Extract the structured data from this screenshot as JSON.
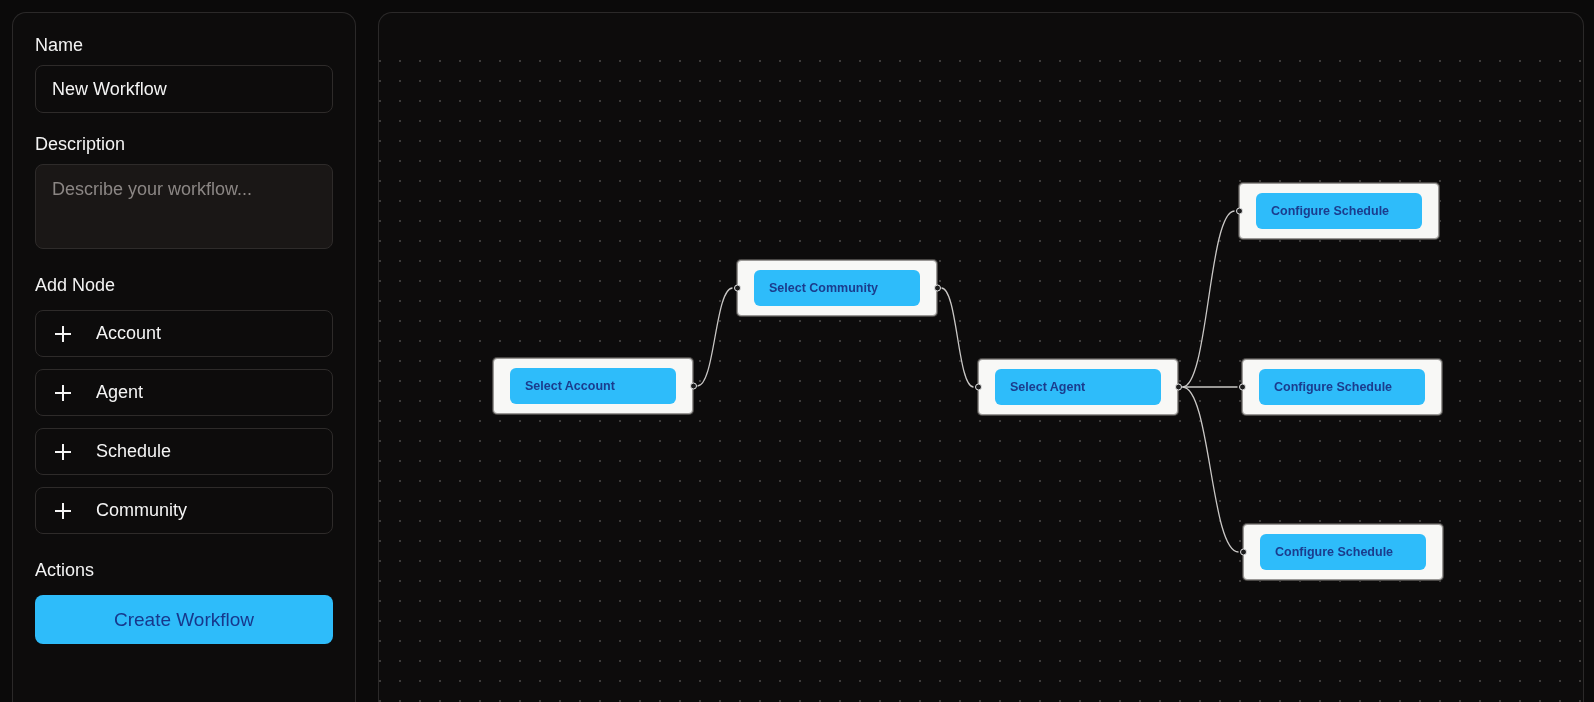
{
  "sidebar": {
    "name_field": {
      "label": "Name",
      "value": "New Workflow"
    },
    "description_field": {
      "label": "Description",
      "placeholder": "Describe your workflow..."
    },
    "add_node": {
      "heading": "Add Node",
      "buttons": [
        {
          "label": "Account"
        },
        {
          "label": "Agent"
        },
        {
          "label": "Schedule"
        },
        {
          "label": "Community"
        }
      ]
    },
    "actions": {
      "heading": "Actions",
      "create_button": {
        "label": "Create Workflow"
      }
    }
  },
  "canvas": {
    "nodes": [
      {
        "label": "Select Account",
        "children": [
          {
            "label": "Select Community",
            "children": [
              {
                "label": "Select Agent",
                "children": [
                  {
                    "label": "Configure Schedule"
                  },
                  {
                    "label": "Configure Schedule"
                  },
                  {
                    "label": "Configure Schedule"
                  }
                ]
              }
            ]
          }
        ]
      }
    ]
  }
}
